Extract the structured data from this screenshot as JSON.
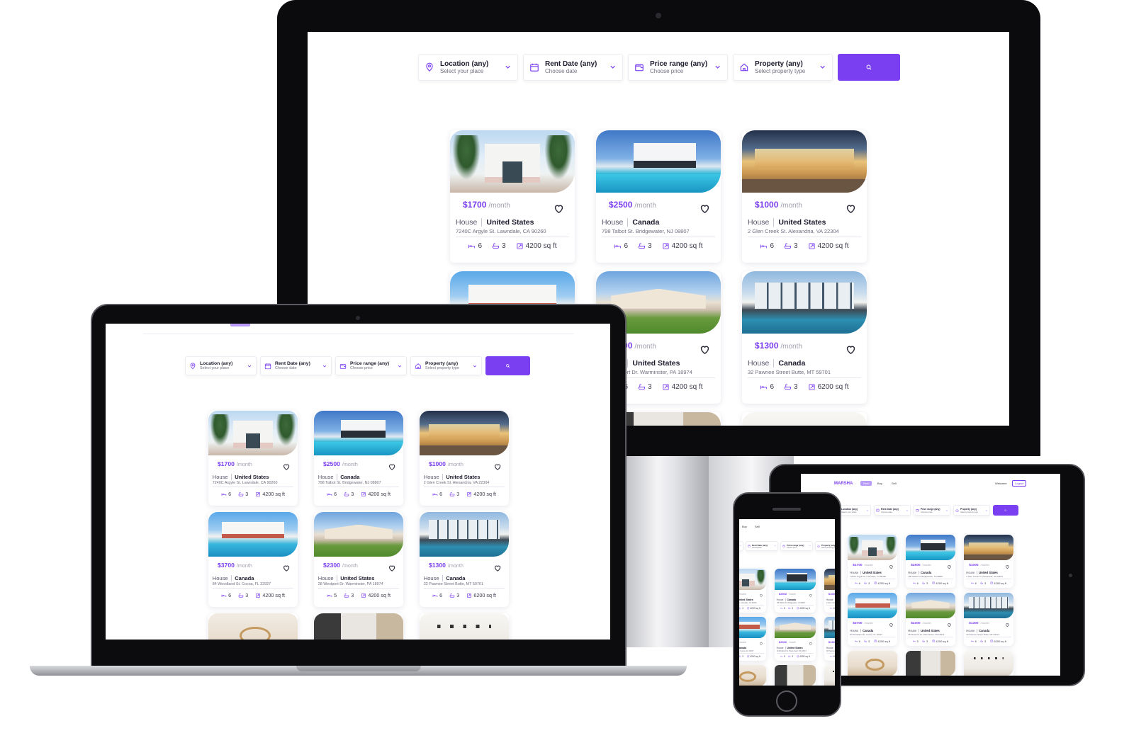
{
  "search": {
    "fields": [
      {
        "title": "Location (any)",
        "subtitle": "Select your place",
        "icon": "map-pin-icon"
      },
      {
        "title": "Rent Date (any)",
        "subtitle": "Choose date",
        "icon": "calendar-icon"
      },
      {
        "title": "Price range (any)",
        "subtitle": "Choose price",
        "icon": "wallet-icon"
      },
      {
        "title": "Property (any)",
        "subtitle": "Select property type",
        "icon": "home-icon"
      }
    ],
    "button_icon": "search-icon"
  },
  "listings": [
    {
      "price": "$1700",
      "period": "/month",
      "type": "House",
      "country": "United States",
      "address": "7240C Argyle St. Lawndale, CA 90260",
      "beds": "6",
      "baths": "3",
      "area": "4200 sq ft",
      "photo": "villa"
    },
    {
      "price": "$2500",
      "period": "/month",
      "type": "House",
      "country": "Canada",
      "address": "798 Talbot St. Bridgewater, NJ 08807",
      "beds": "6",
      "baths": "3",
      "area": "4200 sq ft",
      "photo": "modern"
    },
    {
      "price": "$1000",
      "period": "/month",
      "type": "House",
      "country": "United States",
      "address": "2 Glen Creek St. Alexandria, VA 22304",
      "beds": "6",
      "baths": "3",
      "area": "4200 sq ft",
      "photo": "night"
    },
    {
      "price": "$3700",
      "period": "/month",
      "type": "House",
      "country": "Canada",
      "address": "84 Woodland St. Cocoa, FL 32927",
      "beds": "6",
      "baths": "3",
      "area": "4200 sq ft",
      "photo": "pool"
    },
    {
      "price": "$2300",
      "period": "/month",
      "type": "House",
      "country": "United States",
      "address": "28 Westport Dr. Warminster, PA 18974",
      "beds": "5",
      "baths": "3",
      "area": "4200 sq ft",
      "photo": "ranch"
    },
    {
      "price": "$1300",
      "period": "/month",
      "type": "House",
      "country": "Canada",
      "address": "32 Pawnee Street Butte, MT 59701",
      "beds": "6",
      "baths": "3",
      "area": "6200 sq ft",
      "photo": "glass"
    },
    {
      "photo": "interior"
    },
    {
      "photo": "kitchen"
    },
    {
      "photo": "lights"
    }
  ],
  "tablet_nav": {
    "brand": "MARSHA",
    "links": [
      "Rent",
      "Buy",
      "Sell"
    ],
    "welcome": "Welcome",
    "logout": "Logout"
  },
  "phone_nav": {
    "links": [
      "Buy",
      "Sell"
    ]
  },
  "colors": {
    "accent": "#7B3FF2",
    "text_dark": "#1C1C2E",
    "text_muted": "#6F6F80"
  }
}
